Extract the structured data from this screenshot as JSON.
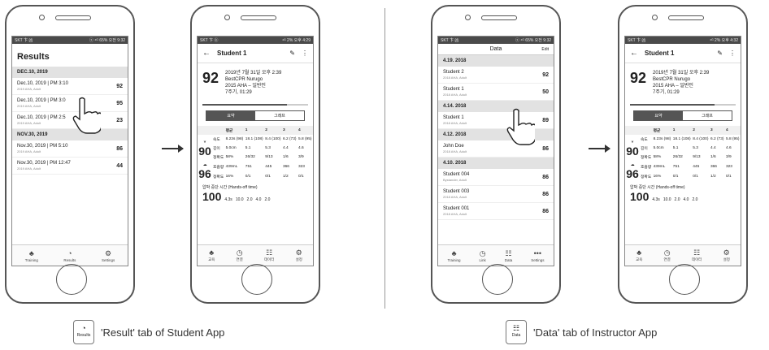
{
  "phone1": {
    "status_left": "SKT 卞 凶",
    "status_right": "ⓢ ⁴ᴳ 65% 오전 9:32",
    "title": "Results",
    "groups": [
      {
        "date": "DEC.10, 2019",
        "rows": [
          {
            "time": "Dec.10, 2019 | PM 3:10",
            "sub": "2019 AHA, Adult",
            "score": "92"
          },
          {
            "time": "Dec.10, 2019 | PM 3:0",
            "sub": "2019 AHA, Adult",
            "score": "95"
          },
          {
            "time": "Dec.10, 2019 | PM 2:5",
            "sub": "2019 AHA, Adult",
            "score": "23"
          }
        ]
      },
      {
        "date": "NOV.30, 2019",
        "rows": [
          {
            "time": "Nov.30, 2019 | PM 5:10",
            "sub": "2019 AHA, Adult",
            "score": "86"
          },
          {
            "time": "Nov.30, 2019 | PM 12:47",
            "sub": "2019 AHA, Adult",
            "score": "44"
          }
        ]
      }
    ],
    "nav": [
      {
        "icon": "♣",
        "label": "Training"
      },
      {
        "icon": "◔",
        "label": "Results"
      },
      {
        "icon": "⚙",
        "label": "Settings"
      }
    ]
  },
  "phone2": {
    "status_left": "SKT 卞 ⓚ",
    "status_right": "⁴ᴳ 2% 오후 4:29",
    "title": "Student 1",
    "score": "92",
    "info": [
      "2019년 7월 31일 오후 2:39",
      "BestCPR Nurugo",
      "2015 AHA – 일반인",
      "7주기, 01:29"
    ],
    "tabs": [
      "요약",
      "그래프"
    ],
    "table_head": [
      "",
      "",
      "평균",
      "1",
      "2",
      "3",
      "4"
    ],
    "rate_label": "속도",
    "rate": [
      "8.23s (98)",
      "18.1 (108)",
      "8.4 (100)",
      "6.2 (73)",
      "5.8 (95)"
    ],
    "depth_score": "90",
    "depth_label": "깊이",
    "depth": [
      "5.0cm",
      "5.1",
      "5.3",
      "4.4",
      "4.6"
    ],
    "acc_label": "정확도",
    "acc": [
      "58%",
      "26/32",
      "9/13",
      "1/6",
      "3/9"
    ],
    "vent_label": "호흡량",
    "vent": [
      "439mL",
      "751",
      "445",
      "366",
      "323"
    ],
    "vent_score": "96",
    "vacc_label": "정확도",
    "vacc": [
      "16%",
      "0/1",
      "0/1",
      "1/2",
      "0/1"
    ],
    "hands_label": "압박 중단 시간 (Hands-off time)",
    "hands": [
      "4.3s",
      "10.0",
      "2.0",
      "4.0",
      "2.0"
    ],
    "hands_score": "100",
    "nav": [
      {
        "icon": "♣",
        "label": "교육"
      },
      {
        "icon": "◷",
        "label": "연결"
      },
      {
        "icon": "☷",
        "label": "데이터"
      },
      {
        "icon": "⚙",
        "label": "설정"
      }
    ]
  },
  "phone3": {
    "status_left": "SKT 卞 凶",
    "status_right": "ⓢ ⁴ᴳ 65% 오전 9:32",
    "title": "Data",
    "edit": "Edit",
    "groups": [
      {
        "date": "4.19. 2018",
        "rows": [
          {
            "name": "Student 2",
            "sub": "2018 AHA, Adult",
            "score": "92"
          },
          {
            "name": "Student 1",
            "sub": "2018 AHA, Adult",
            "score": "50"
          }
        ]
      },
      {
        "date": "4.14. 2018",
        "rows": [
          {
            "name": "Student 1",
            "sub": "2018 AHA, Adult",
            "score": "89"
          }
        ]
      },
      {
        "date": "4.12. 2018",
        "rows": [
          {
            "name": "John Doe",
            "sub": "2018 AHA, Adult",
            "score": "86"
          }
        ]
      },
      {
        "date": "4.10. 2018",
        "rows": [
          {
            "name": "Student 004",
            "sub": "Bystander, Adult",
            "score": "86"
          },
          {
            "name": "Student 003",
            "sub": "2018 AHA, Adult",
            "score": "86"
          },
          {
            "name": "Student 001",
            "sub": "2018 AHA, Adult",
            "score": "86"
          }
        ]
      }
    ],
    "nav": [
      {
        "icon": "♣",
        "label": "Training"
      },
      {
        "icon": "◷",
        "label": "Link"
      },
      {
        "icon": "☷",
        "label": "Data"
      },
      {
        "icon": "•••",
        "label": "Settings"
      }
    ]
  },
  "phone4": {
    "status_left": "SKT 卞 凶",
    "status_right": "⁴ᴳ 2% 오후 4:32",
    "title": "Student 1"
  },
  "captions": {
    "left_badge_label": "Results",
    "left_text": "'Result' tab of Student App",
    "right_badge_label": "Data",
    "right_text": "'Data' tab of Instructor App"
  }
}
